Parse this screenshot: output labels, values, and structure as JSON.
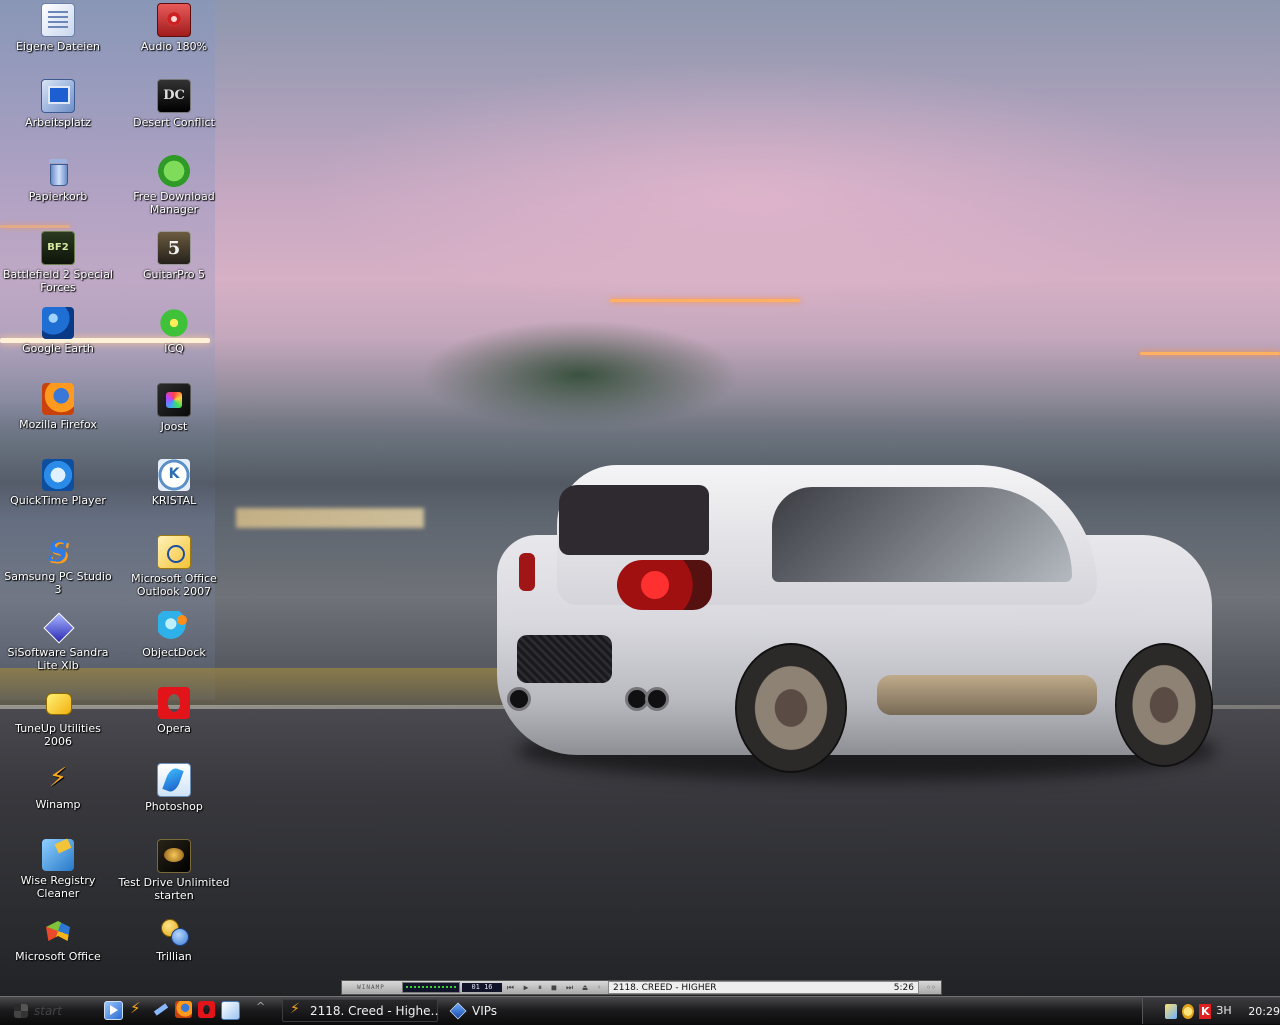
{
  "desktop": {
    "icons_col1": [
      {
        "label": "Eigene Dateien",
        "icon": "my-documents-icon"
      },
      {
        "label": "Arbeitsplatz",
        "icon": "my-computer-icon"
      },
      {
        "label": "Papierkorb",
        "icon": "recycle-bin-icon"
      },
      {
        "label": "Battlefield 2 Special Forces",
        "icon": "battlefield-icon"
      },
      {
        "label": "Google Earth",
        "icon": "google-earth-icon"
      },
      {
        "label": "Mozilla Firefox",
        "icon": "firefox-icon"
      },
      {
        "label": "QuickTime Player",
        "icon": "quicktime-icon"
      },
      {
        "label": "Samsung PC Studio 3",
        "icon": "samsung-pc-studio-icon"
      },
      {
        "label": "SiSoftware Sandra Lite XIb",
        "icon": "sandra-icon"
      },
      {
        "label": "TuneUp Utilities 2006",
        "icon": "tuneup-icon"
      },
      {
        "label": "Winamp",
        "icon": "winamp-icon"
      },
      {
        "label": "Wise Registry Cleaner",
        "icon": "wise-registry-icon"
      },
      {
        "label": "Microsoft Office",
        "icon": "ms-office-icon"
      }
    ],
    "icons_col2": [
      {
        "label": "Audio 180%",
        "icon": "audio-icon"
      },
      {
        "label": "Desert Conflict",
        "icon": "desert-conflict-icon"
      },
      {
        "label": "Free Download Manager",
        "icon": "download-manager-icon"
      },
      {
        "label": "GuitarPro 5",
        "icon": "guitarpro-icon"
      },
      {
        "label": "ICQ",
        "icon": "icq-icon"
      },
      {
        "label": "Joost",
        "icon": "joost-icon"
      },
      {
        "label": "KRISTAL",
        "icon": "kristal-icon"
      },
      {
        "label": "Microsoft Office Outlook 2007",
        "icon": "outlook-icon"
      },
      {
        "label": "ObjectDock",
        "icon": "objectdock-icon"
      },
      {
        "label": "Opera",
        "icon": "opera-icon"
      },
      {
        "label": "Photoshop",
        "icon": "photoshop-icon"
      },
      {
        "label": "Test Drive Unlimited starten",
        "icon": "test-drive-icon"
      },
      {
        "label": "Trillian",
        "icon": "trillian-icon"
      }
    ]
  },
  "winamp_bar": {
    "logo": "WINAMP",
    "time": "01 16",
    "track": "2118. CREED - HIGHER",
    "duration": "5:26",
    "controls": [
      "prev-icon",
      "play-icon",
      "pause-icon",
      "stop-icon",
      "next-icon"
    ]
  },
  "taskbar": {
    "start_label": "start",
    "quick_launch": [
      "winamp-icon",
      "winamp-bolt-icon",
      "tools-icon",
      "firefox-icon",
      "opera-icon",
      "messenger-icon"
    ],
    "tasks": [
      {
        "label": "2118. Creed - Highe…",
        "icon": "winamp-bolt-icon",
        "active": true
      },
      {
        "label": "VIPs",
        "icon": "vips-icon",
        "active": false
      }
    ],
    "tray": {
      "language": "ЗН",
      "clock": "20:29"
    }
  },
  "colors": {
    "taskbar": "#1c1c1e",
    "label_text": "#ffffff"
  }
}
